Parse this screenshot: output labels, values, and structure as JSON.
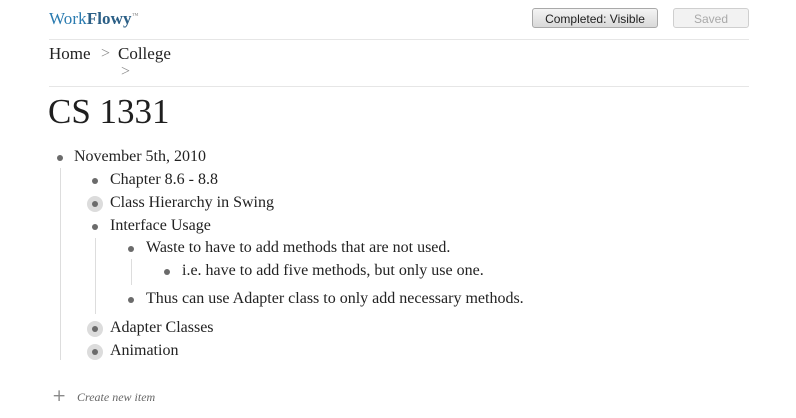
{
  "header": {
    "logo_light": "Work",
    "logo_bold": "Flowy",
    "logo_tm": "™",
    "completed_button": "Completed: Visible",
    "saved_button": "Saved"
  },
  "breadcrumb": {
    "home": "Home",
    "sep": ">",
    "college": "College"
  },
  "page_title": "CS 1331",
  "outline": [
    {
      "text": "November 5th, 2010"
    },
    {
      "text": "Chapter 8.6 - 8.8"
    },
    {
      "text": "Class Hierarchy in Swing",
      "collapsed": true
    },
    {
      "text": "Interface Usage"
    },
    {
      "text": "Waste to have to add methods that are not used."
    },
    {
      "text": "i.e. have to add five methods, but only use one."
    },
    {
      "text": "Thus can use Adapter class to only add necessary methods."
    },
    {
      "text": "Adapter Classes",
      "collapsed": true
    },
    {
      "text": "Animation",
      "collapsed": true
    }
  ],
  "footer": {
    "plus": "+",
    "create_label": "Create new item"
  },
  "colors": {
    "logo": "#2a7bb0",
    "bullet": "#6b6b6b",
    "collapsed_ring": "#dcdcdc"
  }
}
